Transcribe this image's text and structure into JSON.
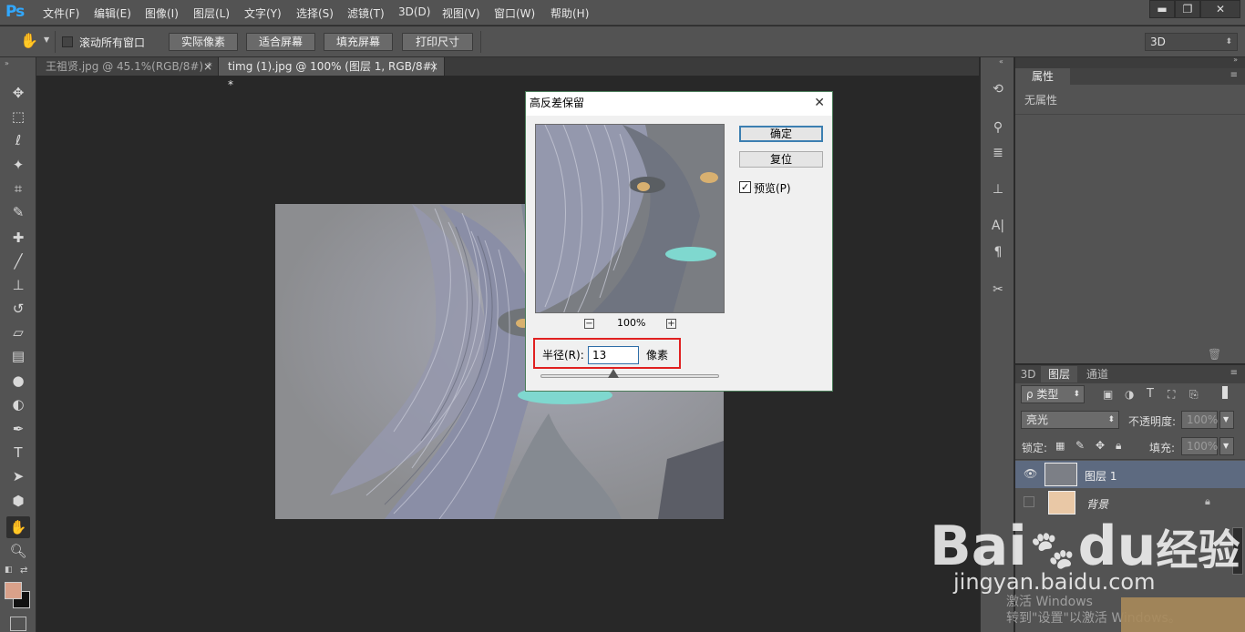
{
  "app": {
    "logo": "Ps"
  },
  "menu": [
    "文件(F)",
    "编辑(E)",
    "图像(I)",
    "图层(L)",
    "文字(Y)",
    "选择(S)",
    "滤镜(T)",
    "3D(D)",
    "视图(V)",
    "窗口(W)",
    "帮助(H)"
  ],
  "window_controls": {
    "minimize": "▬",
    "restore": "❐",
    "close": "✕"
  },
  "options": {
    "scroll_all_label": "滚动所有窗口",
    "scroll_all_checked": false,
    "buttons": [
      "实际像素",
      "适合屏幕",
      "填充屏幕",
      "打印尺寸"
    ],
    "workspace": "3D"
  },
  "tabs": [
    {
      "label": "王祖贤.jpg @ 45.1%(RGB/8#) *",
      "close": "×"
    },
    {
      "label": "timg (1).jpg @ 100% (图层 1, RGB/8#) *",
      "close": "×"
    }
  ],
  "tools_icons": [
    "move-tool-icon",
    "marquee-icon",
    "lasso-icon",
    "magic-wand-icon",
    "crop-icon",
    "eyedropper-icon",
    "healing-brush-icon",
    "brush-icon",
    "clone-stamp-icon",
    "history-brush-icon",
    "eraser-icon",
    "gradient-icon",
    "blur-icon",
    "dodge-icon",
    "pen-icon",
    "type-icon",
    "path-selection-icon",
    "shape-icon",
    "hand-icon",
    "zoom-icon"
  ],
  "colors": {
    "foreground": "#d9a18a",
    "background": "#111111",
    "accent": "#31a8ff",
    "highlight": "#e02020"
  },
  "properties_panel": {
    "tab": "属性",
    "text": "无属性"
  },
  "layers_panel": {
    "tabs": [
      "3D",
      "图层",
      "通道"
    ],
    "kind_filter": "ρ 类型",
    "blend_mode": "亮光",
    "opacity_label": "不透明度:",
    "opacity_value": "100%",
    "lock_label": "锁定:",
    "fill_label": "填充:",
    "fill_value": "100%",
    "layers": [
      {
        "name": "图层 1",
        "visible": true,
        "selected": true
      },
      {
        "name": "背景",
        "visible": false,
        "selected": false,
        "locked": true
      }
    ]
  },
  "dialog": {
    "title": "高反差保留",
    "close": "✕",
    "ok_label": "确定",
    "reset_label": "复位",
    "preview_label": "预览(P)",
    "preview_checked": true,
    "zoom_minus": "−",
    "zoom_plus": "+",
    "zoom_value": "100%",
    "radius_label": "半径(R):",
    "radius_value": "13",
    "unit_label": "像素",
    "radius_slider_level": 0.41
  },
  "watermark": {
    "brand": "Bai",
    "brand2": "du",
    "product": "经验",
    "url": "jingyan.baidu.com"
  },
  "os_notice": {
    "line1": "激活 Windows",
    "line2": "转到\"设置\"以激活 Windows。"
  }
}
